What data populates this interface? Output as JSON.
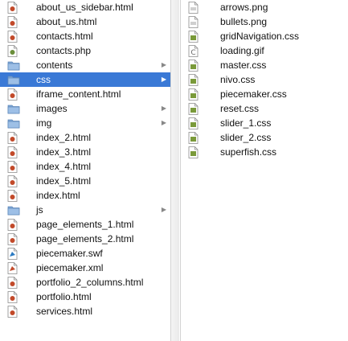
{
  "columns": [
    {
      "items": [
        {
          "name": "about_us_sidebar.html",
          "kind": "html"
        },
        {
          "name": "about_us.html",
          "kind": "html"
        },
        {
          "name": "contacts.html",
          "kind": "html"
        },
        {
          "name": "contacts.php",
          "kind": "php"
        },
        {
          "name": "contents",
          "kind": "folder",
          "has_children": true
        },
        {
          "name": "css",
          "kind": "folder",
          "has_children": true,
          "selected": true
        },
        {
          "name": "iframe_content.html",
          "kind": "html"
        },
        {
          "name": "images",
          "kind": "folder",
          "has_children": true
        },
        {
          "name": "img",
          "kind": "folder",
          "has_children": true
        },
        {
          "name": "index_2.html",
          "kind": "html"
        },
        {
          "name": "index_3.html",
          "kind": "html"
        },
        {
          "name": "index_4.html",
          "kind": "html"
        },
        {
          "name": "index_5.html",
          "kind": "html"
        },
        {
          "name": "index.html",
          "kind": "html"
        },
        {
          "name": "js",
          "kind": "folder",
          "has_children": true
        },
        {
          "name": "page_elements_1.html",
          "kind": "html"
        },
        {
          "name": "page_elements_2.html",
          "kind": "html"
        },
        {
          "name": "piecemaker.swf",
          "kind": "swf"
        },
        {
          "name": "piecemaker.xml",
          "kind": "xml"
        },
        {
          "name": "portfolio_2_columns.html",
          "kind": "html"
        },
        {
          "name": "portfolio.html",
          "kind": "html"
        },
        {
          "name": "services.html",
          "kind": "html"
        }
      ]
    },
    {
      "items": [
        {
          "name": "arrows.png",
          "kind": "image"
        },
        {
          "name": "bullets.png",
          "kind": "image"
        },
        {
          "name": "gridNavigation.css",
          "kind": "css"
        },
        {
          "name": "loading.gif",
          "kind": "gif"
        },
        {
          "name": "master.css",
          "kind": "css"
        },
        {
          "name": "nivo.css",
          "kind": "css"
        },
        {
          "name": "piecemaker.css",
          "kind": "css"
        },
        {
          "name": "reset.css",
          "kind": "css"
        },
        {
          "name": "slider_1.css",
          "kind": "css"
        },
        {
          "name": "slider_2.css",
          "kind": "css"
        },
        {
          "name": "superfish.css",
          "kind": "css"
        }
      ]
    }
  ],
  "colors": {
    "selection": "#3a79d6",
    "folder": "#7fa8d8",
    "html_badge": "#c24a2a",
    "css_badge": "#7a9a3a",
    "php_badge": "#6a8e3a"
  }
}
